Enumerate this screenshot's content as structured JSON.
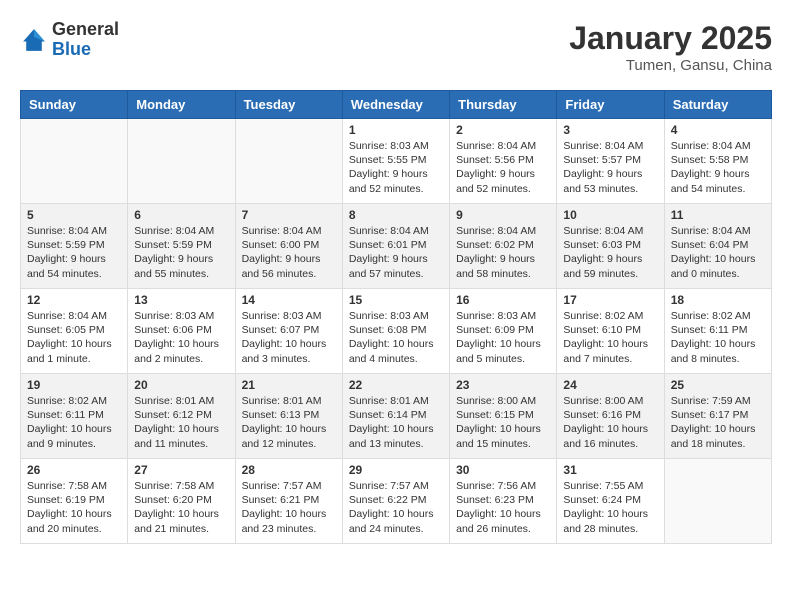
{
  "header": {
    "logo_general": "General",
    "logo_blue": "Blue",
    "month": "January 2025",
    "location": "Tumen, Gansu, China"
  },
  "days_of_week": [
    "Sunday",
    "Monday",
    "Tuesday",
    "Wednesday",
    "Thursday",
    "Friday",
    "Saturday"
  ],
  "weeks": [
    [
      {
        "day": "",
        "content": ""
      },
      {
        "day": "",
        "content": ""
      },
      {
        "day": "",
        "content": ""
      },
      {
        "day": "1",
        "content": "Sunrise: 8:03 AM\nSunset: 5:55 PM\nDaylight: 9 hours\nand 52 minutes."
      },
      {
        "day": "2",
        "content": "Sunrise: 8:04 AM\nSunset: 5:56 PM\nDaylight: 9 hours\nand 52 minutes."
      },
      {
        "day": "3",
        "content": "Sunrise: 8:04 AM\nSunset: 5:57 PM\nDaylight: 9 hours\nand 53 minutes."
      },
      {
        "day": "4",
        "content": "Sunrise: 8:04 AM\nSunset: 5:58 PM\nDaylight: 9 hours\nand 54 minutes."
      }
    ],
    [
      {
        "day": "5",
        "content": "Sunrise: 8:04 AM\nSunset: 5:59 PM\nDaylight: 9 hours\nand 54 minutes."
      },
      {
        "day": "6",
        "content": "Sunrise: 8:04 AM\nSunset: 5:59 PM\nDaylight: 9 hours\nand 55 minutes."
      },
      {
        "day": "7",
        "content": "Sunrise: 8:04 AM\nSunset: 6:00 PM\nDaylight: 9 hours\nand 56 minutes."
      },
      {
        "day": "8",
        "content": "Sunrise: 8:04 AM\nSunset: 6:01 PM\nDaylight: 9 hours\nand 57 minutes."
      },
      {
        "day": "9",
        "content": "Sunrise: 8:04 AM\nSunset: 6:02 PM\nDaylight: 9 hours\nand 58 minutes."
      },
      {
        "day": "10",
        "content": "Sunrise: 8:04 AM\nSunset: 6:03 PM\nDaylight: 9 hours\nand 59 minutes."
      },
      {
        "day": "11",
        "content": "Sunrise: 8:04 AM\nSunset: 6:04 PM\nDaylight: 10 hours\nand 0 minutes."
      }
    ],
    [
      {
        "day": "12",
        "content": "Sunrise: 8:04 AM\nSunset: 6:05 PM\nDaylight: 10 hours\nand 1 minute."
      },
      {
        "day": "13",
        "content": "Sunrise: 8:03 AM\nSunset: 6:06 PM\nDaylight: 10 hours\nand 2 minutes."
      },
      {
        "day": "14",
        "content": "Sunrise: 8:03 AM\nSunset: 6:07 PM\nDaylight: 10 hours\nand 3 minutes."
      },
      {
        "day": "15",
        "content": "Sunrise: 8:03 AM\nSunset: 6:08 PM\nDaylight: 10 hours\nand 4 minutes."
      },
      {
        "day": "16",
        "content": "Sunrise: 8:03 AM\nSunset: 6:09 PM\nDaylight: 10 hours\nand 5 minutes."
      },
      {
        "day": "17",
        "content": "Sunrise: 8:02 AM\nSunset: 6:10 PM\nDaylight: 10 hours\nand 7 minutes."
      },
      {
        "day": "18",
        "content": "Sunrise: 8:02 AM\nSunset: 6:11 PM\nDaylight: 10 hours\nand 8 minutes."
      }
    ],
    [
      {
        "day": "19",
        "content": "Sunrise: 8:02 AM\nSunset: 6:11 PM\nDaylight: 10 hours\nand 9 minutes."
      },
      {
        "day": "20",
        "content": "Sunrise: 8:01 AM\nSunset: 6:12 PM\nDaylight: 10 hours\nand 11 minutes."
      },
      {
        "day": "21",
        "content": "Sunrise: 8:01 AM\nSunset: 6:13 PM\nDaylight: 10 hours\nand 12 minutes."
      },
      {
        "day": "22",
        "content": "Sunrise: 8:01 AM\nSunset: 6:14 PM\nDaylight: 10 hours\nand 13 minutes."
      },
      {
        "day": "23",
        "content": "Sunrise: 8:00 AM\nSunset: 6:15 PM\nDaylight: 10 hours\nand 15 minutes."
      },
      {
        "day": "24",
        "content": "Sunrise: 8:00 AM\nSunset: 6:16 PM\nDaylight: 10 hours\nand 16 minutes."
      },
      {
        "day": "25",
        "content": "Sunrise: 7:59 AM\nSunset: 6:17 PM\nDaylight: 10 hours\nand 18 minutes."
      }
    ],
    [
      {
        "day": "26",
        "content": "Sunrise: 7:58 AM\nSunset: 6:19 PM\nDaylight: 10 hours\nand 20 minutes."
      },
      {
        "day": "27",
        "content": "Sunrise: 7:58 AM\nSunset: 6:20 PM\nDaylight: 10 hours\nand 21 minutes."
      },
      {
        "day": "28",
        "content": "Sunrise: 7:57 AM\nSunset: 6:21 PM\nDaylight: 10 hours\nand 23 minutes."
      },
      {
        "day": "29",
        "content": "Sunrise: 7:57 AM\nSunset: 6:22 PM\nDaylight: 10 hours\nand 24 minutes."
      },
      {
        "day": "30",
        "content": "Sunrise: 7:56 AM\nSunset: 6:23 PM\nDaylight: 10 hours\nand 26 minutes."
      },
      {
        "day": "31",
        "content": "Sunrise: 7:55 AM\nSunset: 6:24 PM\nDaylight: 10 hours\nand 28 minutes."
      },
      {
        "day": "",
        "content": ""
      }
    ]
  ]
}
